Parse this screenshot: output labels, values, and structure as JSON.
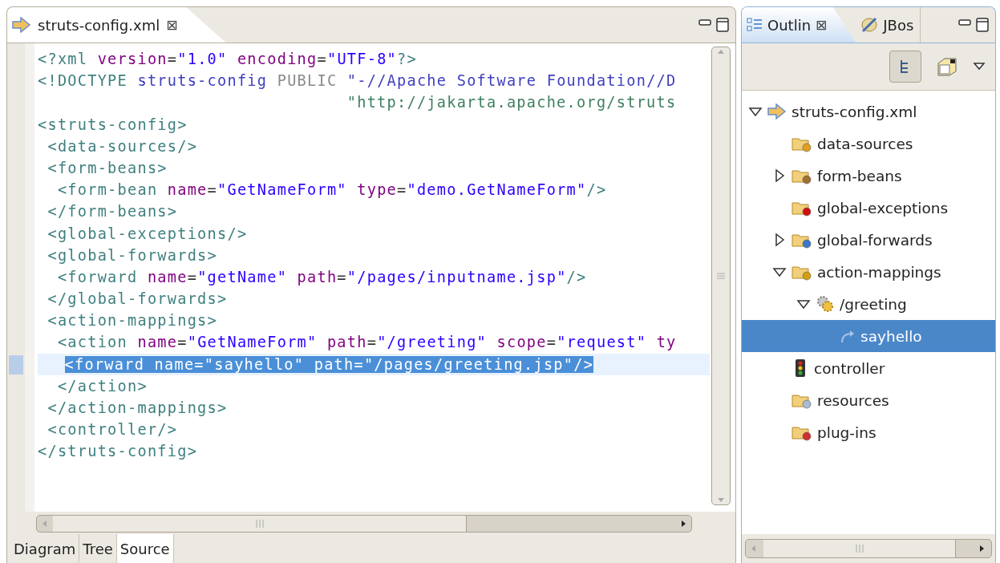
{
  "editor": {
    "tab": {
      "title": "struts-config.xml",
      "close": "⊠"
    },
    "lines": [
      {
        "current": false,
        "tokens": [
          {
            "kind": "tag",
            "text": "<?xml "
          },
          {
            "kind": "attr",
            "text": "version"
          },
          {
            "kind": "eq",
            "text": "="
          },
          {
            "kind": "value",
            "text": "\"1.0\" "
          },
          {
            "kind": "attr",
            "text": "encoding"
          },
          {
            "kind": "eq",
            "text": "="
          },
          {
            "kind": "value",
            "text": "\"UTF-8\""
          },
          {
            "kind": "tag",
            "text": "?>"
          }
        ]
      },
      {
        "current": false,
        "tokens": [
          {
            "kind": "tag",
            "text": "<!DOCTYPE "
          },
          {
            "kind": "doctype",
            "text": "struts-config "
          },
          {
            "kind": "keyword",
            "text": "PUBLIC "
          },
          {
            "kind": "doctype",
            "text": "\"-//Apache Software Foundation//D"
          }
        ]
      },
      {
        "current": false,
        "tokens": [
          {
            "kind": "sysid",
            "text": "                               \"http://jakarta.apache.org/struts"
          }
        ]
      },
      {
        "current": false,
        "tokens": [
          {
            "kind": "tag",
            "text": "<struts-config>"
          }
        ]
      },
      {
        "current": false,
        "tokens": [
          {
            "kind": "tag",
            "text": " <data-sources/>"
          }
        ]
      },
      {
        "current": false,
        "tokens": [
          {
            "kind": "tag",
            "text": " <form-beans>"
          }
        ]
      },
      {
        "current": false,
        "tokens": [
          {
            "kind": "tag",
            "text": "  <form-bean "
          },
          {
            "kind": "attr",
            "text": "name"
          },
          {
            "kind": "eq",
            "text": "="
          },
          {
            "kind": "value",
            "text": "\"GetNameForm\" "
          },
          {
            "kind": "attr",
            "text": "type"
          },
          {
            "kind": "eq",
            "text": "="
          },
          {
            "kind": "value",
            "text": "\"demo.GetNameForm\""
          },
          {
            "kind": "tag",
            "text": "/>"
          }
        ]
      },
      {
        "current": false,
        "tokens": [
          {
            "kind": "tag",
            "text": " </form-beans>"
          }
        ]
      },
      {
        "current": false,
        "tokens": [
          {
            "kind": "tag",
            "text": " <global-exceptions/>"
          }
        ]
      },
      {
        "current": false,
        "tokens": [
          {
            "kind": "tag",
            "text": " <global-forwards>"
          }
        ]
      },
      {
        "current": false,
        "tokens": [
          {
            "kind": "tag",
            "text": "  <forward "
          },
          {
            "kind": "attr",
            "text": "name"
          },
          {
            "kind": "eq",
            "text": "="
          },
          {
            "kind": "value",
            "text": "\"getName\" "
          },
          {
            "kind": "attr",
            "text": "path"
          },
          {
            "kind": "eq",
            "text": "="
          },
          {
            "kind": "value",
            "text": "\"/pages/inputname.jsp\""
          },
          {
            "kind": "tag",
            "text": "/>"
          }
        ]
      },
      {
        "current": false,
        "tokens": [
          {
            "kind": "tag",
            "text": " </global-forwards>"
          }
        ]
      },
      {
        "current": false,
        "tokens": [
          {
            "kind": "tag",
            "text": " <action-mappings>"
          }
        ]
      },
      {
        "current": false,
        "tokens": [
          {
            "kind": "tag",
            "text": "  <action "
          },
          {
            "kind": "attr",
            "text": "name"
          },
          {
            "kind": "eq",
            "text": "="
          },
          {
            "kind": "value",
            "text": "\"GetNameForm\" "
          },
          {
            "kind": "attr",
            "text": "path"
          },
          {
            "kind": "eq",
            "text": "="
          },
          {
            "kind": "value",
            "text": "\"/greeting\" "
          },
          {
            "kind": "attr",
            "text": "scope"
          },
          {
            "kind": "eq",
            "text": "="
          },
          {
            "kind": "value",
            "text": "\"request\" "
          },
          {
            "kind": "attr",
            "text": "ty"
          }
        ]
      },
      {
        "current": true,
        "tokens": [
          {
            "kind": "selection",
            "text": "<forward name=\"sayhello\" path=\"/pages/greeting.jsp\"/>"
          }
        ]
      },
      {
        "current": false,
        "tokens": [
          {
            "kind": "tag",
            "text": "  </action>"
          }
        ]
      },
      {
        "current": false,
        "tokens": [
          {
            "kind": "tag",
            "text": " </action-mappings>"
          }
        ]
      },
      {
        "current": false,
        "tokens": [
          {
            "kind": "tag",
            "text": " <controller/>"
          }
        ]
      },
      {
        "current": false,
        "tokens": [
          {
            "kind": "tag",
            "text": "</struts-config>"
          }
        ]
      }
    ],
    "bottom_tabs": [
      {
        "label": "Diagram",
        "selected": false
      },
      {
        "label": "Tree",
        "selected": false
      },
      {
        "label": "Source",
        "selected": true
      }
    ]
  },
  "outline": {
    "tabs": [
      {
        "label": "Outlin",
        "close": "⊠",
        "selected": true
      },
      {
        "label": "JBos",
        "selected": false
      }
    ],
    "tree": [
      {
        "label": "struts-config.xml",
        "kind": "file",
        "has_children": true,
        "expanded": true,
        "selected": false,
        "children": [
          {
            "label": "data-sources",
            "kind": "folder-db",
            "has_children": false,
            "expanded": false,
            "selected": false
          },
          {
            "label": "form-beans",
            "kind": "folder-beans",
            "has_children": true,
            "expanded": false,
            "selected": false
          },
          {
            "label": "global-exceptions",
            "kind": "folder-error",
            "has_children": false,
            "expanded": false,
            "selected": false
          },
          {
            "label": "global-forwards",
            "kind": "folder-forward",
            "has_children": true,
            "expanded": false,
            "selected": false
          },
          {
            "label": "action-mappings",
            "kind": "folder-gear",
            "has_children": true,
            "expanded": true,
            "selected": false,
            "children": [
              {
                "label": "/greeting",
                "kind": "gear",
                "has_children": true,
                "expanded": true,
                "selected": false,
                "children": [
                  {
                    "label": "sayhello",
                    "kind": "forward",
                    "has_children": false,
                    "expanded": false,
                    "selected": true
                  }
                ]
              }
            ]
          },
          {
            "label": "controller",
            "kind": "traffic-light",
            "has_children": false,
            "expanded": false,
            "selected": false
          },
          {
            "label": "resources",
            "kind": "folder-doc",
            "has_children": false,
            "expanded": false,
            "selected": false
          },
          {
            "label": "plug-ins",
            "kind": "folder-plugin",
            "has_children": false,
            "expanded": false,
            "selected": false
          }
        ]
      }
    ]
  }
}
